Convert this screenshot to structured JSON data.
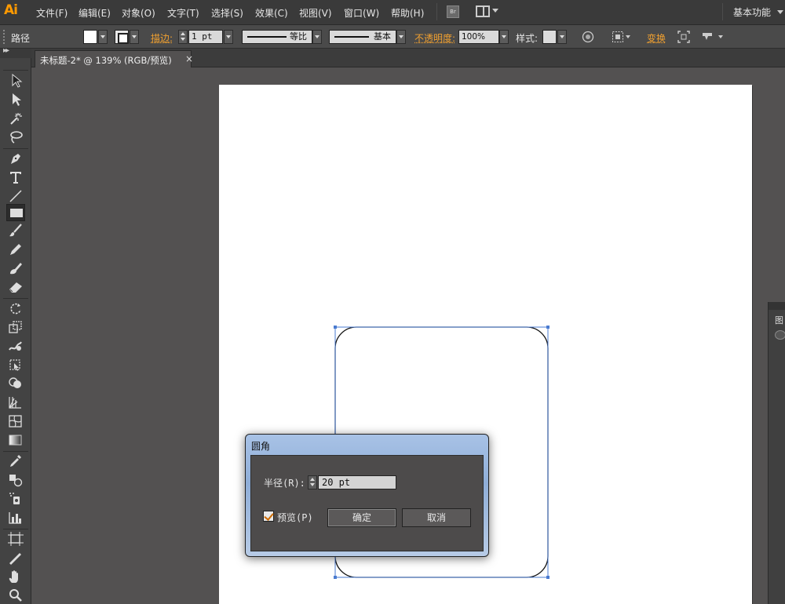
{
  "app": {
    "logo": "Ai"
  },
  "menubar": {
    "items": [
      "文件(F)",
      "编辑(E)",
      "对象(O)",
      "文字(T)",
      "选择(S)",
      "效果(C)",
      "视图(V)",
      "窗口(W)",
      "帮助(H)"
    ],
    "bridge": "Br",
    "workspace": "基本功能"
  },
  "controlbar": {
    "selection_type": "路径",
    "stroke_label": "描边:",
    "stroke_weight": "1 pt",
    "variable_width": "等比",
    "brush_profile": "基本",
    "opacity_label": "不透明度:",
    "opacity": "100%",
    "style_label": "样式:",
    "transform_label": "变换"
  },
  "document_tab": {
    "label": "未标题-2* @ 139% (RGB/预览)",
    "close": "×"
  },
  "toolbox": {
    "tools": [
      "selection-tool",
      "direct-selection-tool",
      "magic-wand-tool",
      "lasso-tool",
      "pen-tool",
      "type-tool",
      "line-segment-tool",
      "rectangle-tool",
      "paintbrush-tool",
      "pencil-tool",
      "blob-brush-tool",
      "eraser-tool",
      "rotate-tool",
      "scale-tool",
      "warp-tool",
      "free-transform-tool",
      "shape-builder-tool",
      "perspective-grid-tool",
      "mesh-tool",
      "gradient-tool",
      "eyedropper-tool",
      "blend-tool",
      "symbol-sprayer-tool",
      "column-graph-tool",
      "artboard-tool",
      "slice-tool",
      "hand-tool",
      "zoom-tool"
    ],
    "active": "rectangle-tool"
  },
  "right_panel": {
    "label": "图"
  },
  "dialog": {
    "title": "圆角",
    "radius_label": "半径(R):",
    "radius_value": "20 pt",
    "preview_label": "预览(P)",
    "preview_checked": true,
    "ok_label": "确定",
    "cancel_label": "取消"
  },
  "colors": {
    "accent": "#f0a030",
    "selection": "#4a7bd0",
    "logo": "#ff9a00"
  }
}
